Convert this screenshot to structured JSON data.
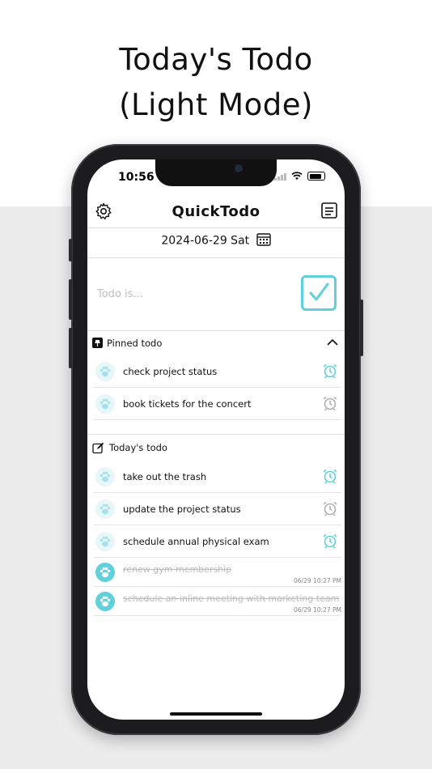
{
  "headline": {
    "line1": "Today's Todo",
    "line2": "(Light Mode)"
  },
  "status_bar": {
    "time": "10:56"
  },
  "nav": {
    "title": "QuickTodo",
    "settings_icon": "gear-icon",
    "memo_icon": "memo-icon"
  },
  "date": {
    "label": "2024-06-29 Sat",
    "icon": "calendar-icon"
  },
  "input": {
    "placeholder": "Todo is...",
    "value": ""
  },
  "pinned": {
    "label": "Pinned todo",
    "items": [
      {
        "text": "check project status",
        "alarm": "active"
      },
      {
        "text": "book tickets for the concert",
        "alarm": "inactive"
      }
    ]
  },
  "today": {
    "label": "Today's todo",
    "items": [
      {
        "text": "take out the trash",
        "alarm": "active"
      },
      {
        "text": "update the project status",
        "alarm": "inactive"
      },
      {
        "text": "schedule annual physical exam",
        "alarm": "active"
      }
    ],
    "done": [
      {
        "text": "renew gym membership",
        "timestamp": "06/29 10:27 PM"
      },
      {
        "text": "schedule an inline meeting with marketing team",
        "timestamp": "06/29 10:27 PM"
      }
    ]
  },
  "colors": {
    "accent": "#5fd0dc",
    "paw_light": "#e6f6f9",
    "alarm_inactive": "#b0b0b0"
  }
}
